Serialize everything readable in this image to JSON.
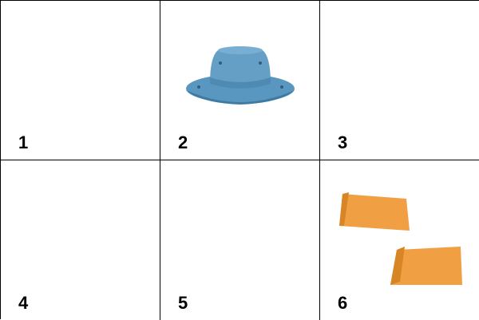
{
  "grid": {
    "cells": [
      {
        "number": "1",
        "content": "empty"
      },
      {
        "number": "2",
        "content": "hat-icon"
      },
      {
        "number": "3",
        "content": "empty"
      },
      {
        "number": "4",
        "content": "empty"
      },
      {
        "number": "5",
        "content": "empty"
      },
      {
        "number": "6",
        "content": "envelope-icon"
      }
    ]
  },
  "colors": {
    "hat": "#5f9dc6",
    "hat_shadow": "#3f7aa3",
    "envelope": "#f0a043",
    "envelope_flap": "#d88625",
    "border": "#000000"
  }
}
